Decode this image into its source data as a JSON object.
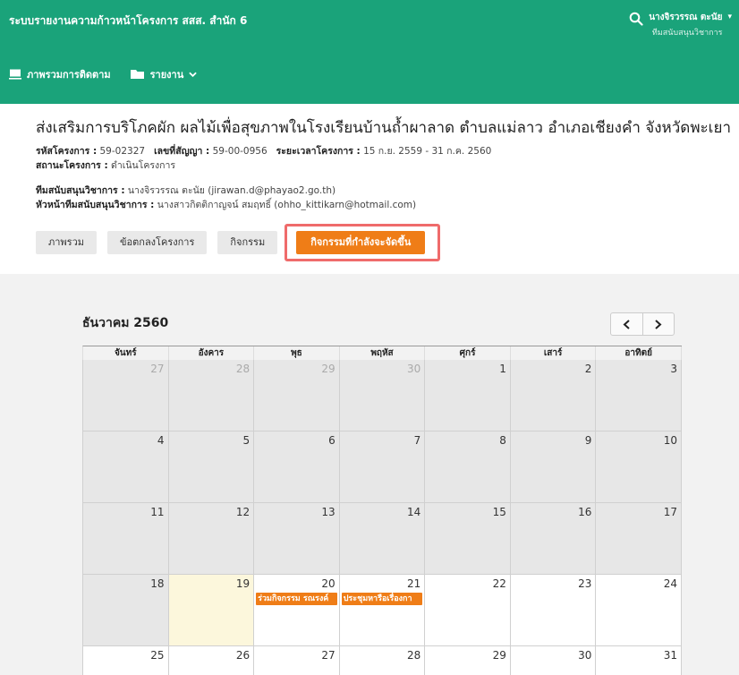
{
  "header": {
    "app_title": "ระบบรายงานความก้าวหน้าโครงการ สสส. สำนัก 6",
    "user_name": "นางจิรวรรณ ตะนัย",
    "user_role": "ทีมสนับสนุนวิชาการ"
  },
  "nav": [
    {
      "label": "ภาพรวมการติดตาม",
      "icon": "monitor-icon"
    },
    {
      "label": "รายงาน",
      "icon": "folder-icon"
    }
  ],
  "project": {
    "title": "ส่งเสริมการบริโภคผัก ผลไม้เพื่อสุขภาพในโรงเรียนบ้านถ้ำผาลาด ตำบลแม่ลาว อำเภอเชียงคำ จังหวัดพะเยา",
    "code_label": "รหัสโครงการ :",
    "code": "59-02327",
    "contract_label": "เลขที่สัญญา :",
    "contract": "59-00-0956",
    "period_label": "ระยะเวลาโครงการ :",
    "period": "15 ก.ย. 2559 - 31 ก.ค. 2560",
    "status_label": "สถานะโครงการ :",
    "status": "ดำเนินโครงการ",
    "support_label": "ทีมสนับสนุนวิชาการ :",
    "support": "นางจิรวรรณ ตะนัย (jirawan.d@phayao2.go.th)",
    "lead_label": "หัวหน้าทีมสนับสนุนวิชาการ :",
    "lead": "นางสาวกิตติกาญจน์ สมฤทธิ์ (ohho_kittikarn@hotmail.com)"
  },
  "tabs": [
    "ภาพรวม",
    "ข้อตกลงโครงการ",
    "กิจกรรม"
  ],
  "active_tab": "กิจกรรมที่กำลังจะจัดขึ้น",
  "calendar": {
    "month_label": "ธันวาคม 2560",
    "weekdays": [
      "จันทร์",
      "อังคาร",
      "พุธ",
      "พฤหัส",
      "ศุกร์",
      "เสาร์",
      "อาทิตย์"
    ],
    "weeks": [
      [
        {
          "d": "27",
          "t": "other"
        },
        {
          "d": "28",
          "t": "other"
        },
        {
          "d": "29",
          "t": "other"
        },
        {
          "d": "30",
          "t": "other"
        },
        {
          "d": "1",
          "t": "past"
        },
        {
          "d": "2",
          "t": "past"
        },
        {
          "d": "3",
          "t": "past"
        }
      ],
      [
        {
          "d": "4",
          "t": "past"
        },
        {
          "d": "5",
          "t": "past"
        },
        {
          "d": "6",
          "t": "past"
        },
        {
          "d": "7",
          "t": "past"
        },
        {
          "d": "8",
          "t": "past"
        },
        {
          "d": "9",
          "t": "past"
        },
        {
          "d": "10",
          "t": "past"
        }
      ],
      [
        {
          "d": "11",
          "t": "past"
        },
        {
          "d": "12",
          "t": "past"
        },
        {
          "d": "13",
          "t": "past"
        },
        {
          "d": "14",
          "t": "past"
        },
        {
          "d": "15",
          "t": "past"
        },
        {
          "d": "16",
          "t": "past"
        },
        {
          "d": "17",
          "t": "past"
        }
      ],
      [
        {
          "d": "18",
          "t": "past"
        },
        {
          "d": "19",
          "t": "today"
        },
        {
          "d": "20",
          "t": "future",
          "event": "ร่วมกิจกรรม รณรงค์"
        },
        {
          "d": "21",
          "t": "future",
          "event": "ประชุมหารือเรื่องกา"
        },
        {
          "d": "22",
          "t": "future"
        },
        {
          "d": "23",
          "t": "future"
        },
        {
          "d": "24",
          "t": "future"
        }
      ],
      [
        {
          "d": "25",
          "t": "future"
        },
        {
          "d": "26",
          "t": "future"
        },
        {
          "d": "27",
          "t": "future"
        },
        {
          "d": "28",
          "t": "future"
        },
        {
          "d": "29",
          "t": "future"
        },
        {
          "d": "30",
          "t": "future"
        },
        {
          "d": "31",
          "t": "future"
        }
      ]
    ]
  },
  "colors": {
    "brand": "#1aa37a",
    "accent": "#ef7d17",
    "highlight_border": "#ef6b6b",
    "today": "#fcf7dc"
  }
}
